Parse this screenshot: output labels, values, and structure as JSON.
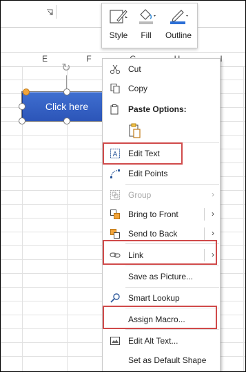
{
  "spreadsheet": {
    "columns": [
      "E",
      "F",
      "G",
      "H",
      "I"
    ]
  },
  "shape": {
    "label": "Click here",
    "fill_color": "#3360c4"
  },
  "mini_toolbar": {
    "buttons": [
      {
        "label": "Style",
        "icon": "shape-style-icon"
      },
      {
        "label": "Fill",
        "icon": "paint-bucket-icon"
      },
      {
        "label": "Outline",
        "icon": "pen-outline-icon"
      }
    ]
  },
  "context_menu": {
    "items": [
      {
        "label": "Cut",
        "icon": "scissors-icon"
      },
      {
        "label": "Copy",
        "icon": "copy-icon"
      },
      {
        "label": "Paste Options:",
        "icon": "clipboard-icon"
      },
      {
        "label": "Edit Text",
        "icon": "edit-text-icon"
      },
      {
        "label": "Edit Points",
        "icon": "edit-points-icon"
      },
      {
        "label": "Group",
        "icon": "group-icon",
        "disabled": true
      },
      {
        "label": "Bring to Front",
        "icon": "bring-to-front-icon"
      },
      {
        "label": "Send to Back",
        "icon": "send-to-back-icon"
      },
      {
        "label": "Link",
        "icon": "link-icon"
      },
      {
        "label": "Save as Picture...",
        "icon": ""
      },
      {
        "label": "Smart Lookup",
        "icon": "search-icon"
      },
      {
        "label": "Assign Macro...",
        "icon": ""
      },
      {
        "label": "Edit Alt Text...",
        "icon": "alt-text-icon"
      },
      {
        "label": "Set as Default Shape",
        "icon": ""
      }
    ]
  },
  "colors": {
    "highlight": "#d04a4a",
    "accent": "#2b579a"
  }
}
